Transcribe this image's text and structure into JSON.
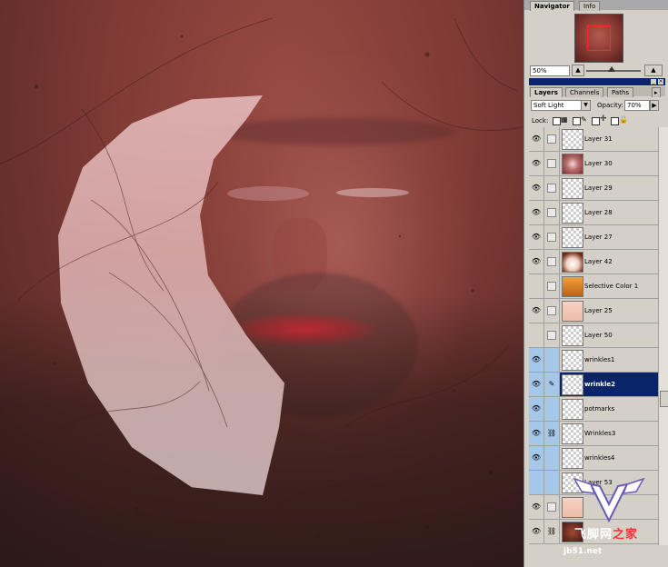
{
  "navigator_panel": {
    "tabs": [
      {
        "label": "Navigator"
      },
      {
        "label": "Info"
      }
    ],
    "zoom": "50%"
  },
  "layers_panel": {
    "tabs": [
      {
        "label": "Layers"
      },
      {
        "label": "Channels"
      },
      {
        "label": "Paths"
      }
    ],
    "blend_mode": "Soft Light",
    "opacity_label": "Opacity:",
    "opacity": "70%",
    "lock_label": "Lock:",
    "layers": [
      {
        "name": "Layer 31",
        "eye": true
      },
      {
        "name": "Layer 30",
        "eye": true
      },
      {
        "name": "Layer 29",
        "eye": true
      },
      {
        "name": "Layer 28",
        "eye": true
      },
      {
        "name": "Layer 27",
        "eye": true
      },
      {
        "name": "Layer 42",
        "eye": true
      },
      {
        "name": "Selective Color 1",
        "eye": false
      },
      {
        "name": "Layer 25",
        "eye": true
      },
      {
        "name": "Layer 50",
        "eye": false
      },
      {
        "name": "wrinkles1",
        "eye": true
      },
      {
        "name": "wrinkle2",
        "eye": true,
        "selected": true
      },
      {
        "name": "potmarks",
        "eye": true
      },
      {
        "name": "Wrinkles3",
        "eye": true
      },
      {
        "name": "wrinkles4",
        "eye": true
      },
      {
        "name": "Layer 53",
        "eye": true
      },
      {
        "name": "",
        "eye": true
      },
      {
        "name": "",
        "eye": true
      }
    ]
  },
  "watermark": {
    "brand_cn_1": "飞脚网",
    "brand_cn_2": "之家",
    "url": "jb51.net"
  },
  "colors": {
    "selection": "#0a246a",
    "link_highlight": "#a6c8e8",
    "panel_bg": "#d4d0c8"
  }
}
